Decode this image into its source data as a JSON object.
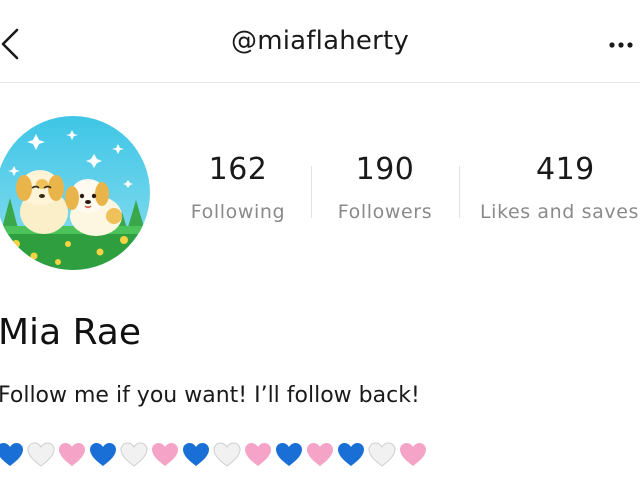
{
  "header": {
    "username": "@miaflaherty",
    "back_icon": "chevron-left-icon",
    "more_icon": "more-horizontal-icon"
  },
  "profile": {
    "avatar": "avatar-puppies-illustration",
    "display_name": "Mia Rae",
    "bio": "Follow me if you want! I’ll follow back!"
  },
  "stats": [
    {
      "value": "162",
      "label": "Following"
    },
    {
      "value": "190",
      "label": "Followers"
    },
    {
      "value": "419",
      "label": "Likes and saves"
    }
  ],
  "heart_row": [
    "blue",
    "white",
    "pink",
    "blue",
    "white",
    "pink",
    "blue",
    "white",
    "pink",
    "blue",
    "pink",
    "blue",
    "white",
    "pink"
  ],
  "colors": {
    "blue": "#1a6fd6",
    "pink": "#f5a3c7",
    "white": "#f1f1f1",
    "text": "#1a1a1a",
    "muted": "#8a8a8a"
  }
}
